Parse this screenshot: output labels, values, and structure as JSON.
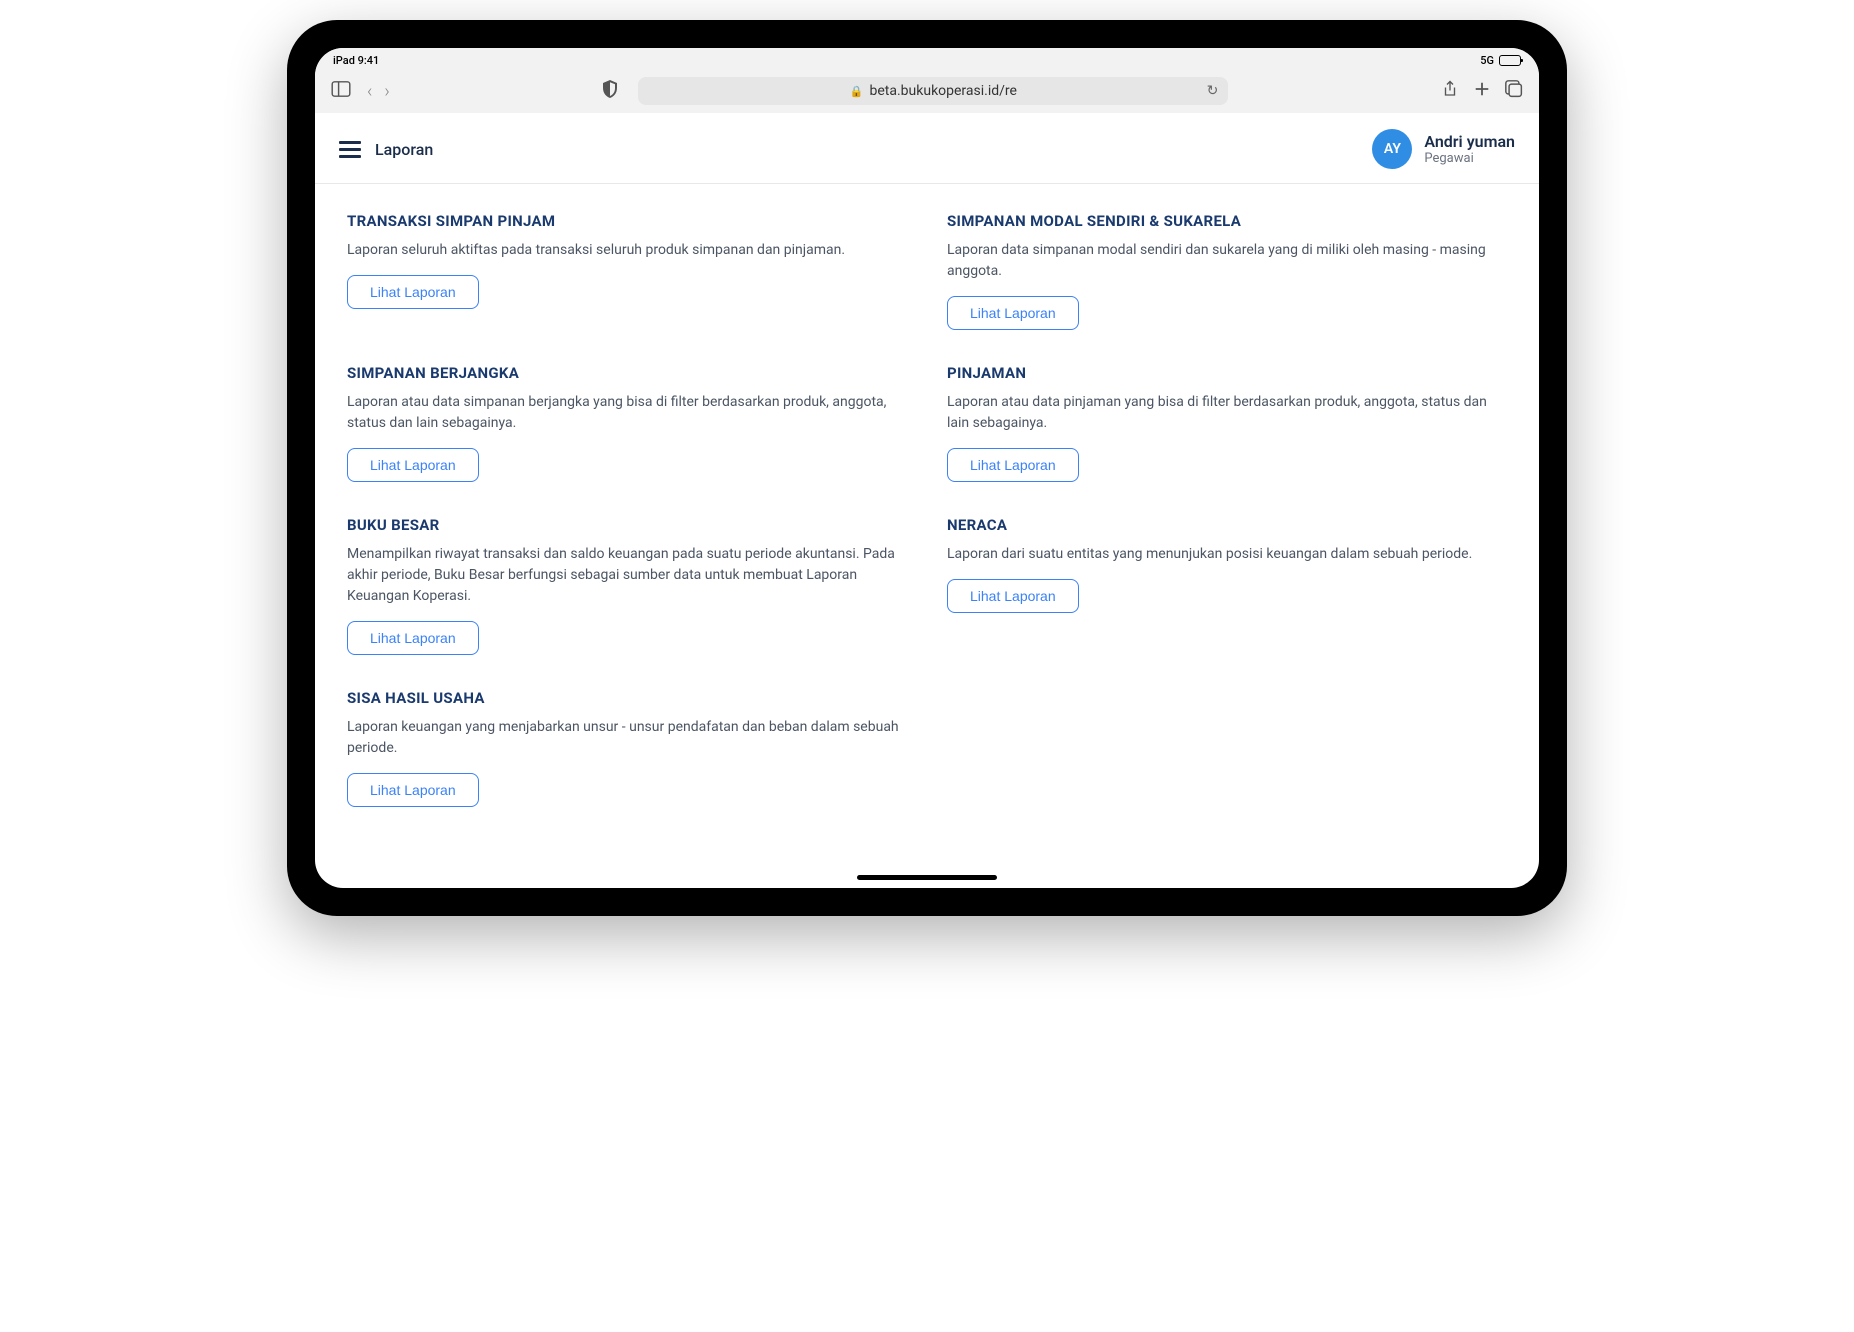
{
  "status": {
    "device": "iPad",
    "time": "9:41",
    "network": "5G"
  },
  "browser": {
    "url": "beta.bukukoperasi.id/re"
  },
  "header": {
    "page_title": "Laporan",
    "user": {
      "initials": "AY",
      "name": "Andri yuman",
      "role": "Pegawai"
    }
  },
  "button_label": "Lihat Laporan",
  "reports": [
    {
      "title": "TRANSAKSI SIMPAN PINJAM",
      "desc": "Laporan seluruh aktiftas pada transaksi seluruh produk simpanan dan pinjaman."
    },
    {
      "title": "SIMPANAN MODAL SENDIRI & SUKARELA",
      "desc": "Laporan data simpanan modal sendiri dan sukarela yang di miliki oleh masing - masing anggota."
    },
    {
      "title": "SIMPANAN BERJANGKA",
      "desc": "Laporan atau data simpanan berjangka yang bisa di filter berdasarkan produk, anggota, status dan lain sebagainya."
    },
    {
      "title": "PINJAMAN",
      "desc": "Laporan atau data pinjaman yang bisa di filter berdasarkan produk, anggota, status dan lain sebagainya."
    },
    {
      "title": "BUKU BESAR",
      "desc": "Menampilkan riwayat transaksi dan saldo keuangan pada suatu periode akuntansi. Pada akhir periode, Buku Besar berfungsi sebagai sumber data untuk membuat Laporan Keuangan Koperasi."
    },
    {
      "title": "NERACA",
      "desc": "Laporan dari suatu entitas yang menunjukan posisi keuangan dalam sebuah periode."
    },
    {
      "title": "SISA HASIL USAHA",
      "desc": "Laporan keuangan yang menjabarkan unsur - unsur pendafatan dan beban dalam sebuah periode."
    }
  ]
}
